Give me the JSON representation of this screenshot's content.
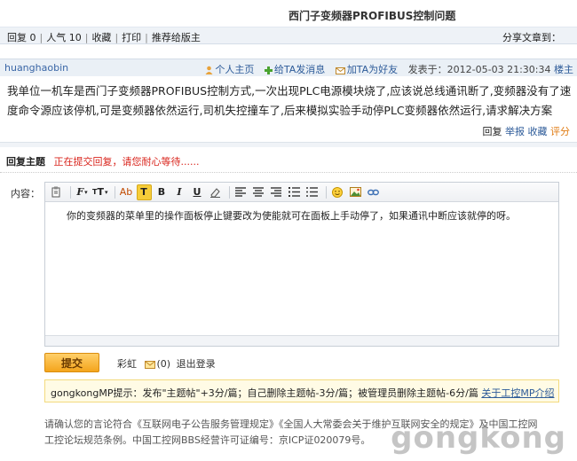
{
  "page_title": "西门子变频器PROFIBUS控制问题",
  "action_bar": {
    "reply_count": "回复 0",
    "views": "人气 10",
    "favorite": "收藏",
    "print": "打印",
    "recommend": "推荐给版主",
    "share": "分享文章到："
  },
  "author_bar": {
    "author": "huanghaobin",
    "home": "个人主页",
    "message": "给TA发消息",
    "add_friend": "加TA为好友",
    "posted_at": "发表于：2012-05-03 21:30:34",
    "floor": "楼主"
  },
  "post": {
    "body": "我单位一机车是西门子变频器PROFIBUS控制方式,一次出现PLC电源模块烧了,应该说总线通讯断了,变频器没有了速度命令源应该停机,可是变频器依然运行,司机失控撞车了,后来模拟实验手动停PLC变频器依然运行,请求解决方案",
    "actions": {
      "reply": "回复",
      "report": "举报",
      "favorite": "收藏",
      "rate": "评分"
    }
  },
  "reply": {
    "label": "回复主题",
    "status": "正在提交回复，请您耐心等待......",
    "content_label": "内容：",
    "editor_text": "你的变频器的菜单里的操作面板停止键要改为使能就可在面板上手动停了，如果通讯中断应该就停的呀。",
    "submit": "提交",
    "user": "彩虹",
    "message_count": "(0)",
    "logout": "退出登录"
  },
  "toolbar": {
    "font": "F",
    "size": "T",
    "color": "Ab",
    "highlight": "T",
    "bold": "B",
    "italic": "I",
    "underline": "U"
  },
  "tip": {
    "text": "gongkongMP提示：发布\"主题帖\"+3分/篇；自己删除主题帖-3分/篇；被管理员删除主题帖-6分/篇",
    "link": "关于工控MP介绍"
  },
  "legal": "请确认您的言论符合《互联网电子公告服务管理规定》《全国人大常委会关于维护互联网安全的规定》及中国工控网工控论坛规范条例。中国工控网BBS经营许可证编号：京ICP证020079号。",
  "watermark": "gongkong",
  "colors": {
    "accent": "#2d5b99",
    "warning": "#d9251d",
    "button": "#f4a51c"
  }
}
